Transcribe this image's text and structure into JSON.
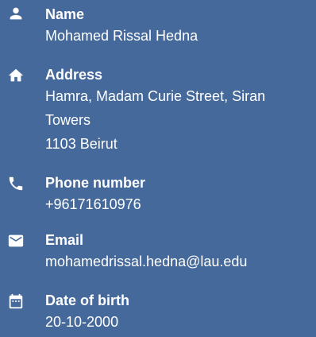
{
  "profile": {
    "name": {
      "label": "Name",
      "value": "Mohamed Rissal Hedna",
      "icon": "person-icon"
    },
    "address": {
      "label": "Address",
      "lines": [
        "Hamra, Madam Curie Street, Siran",
        "Towers",
        "1103 Beirut"
      ],
      "icon": "home-icon"
    },
    "phone": {
      "label": "Phone number",
      "value": "+96171610976",
      "icon": "phone-icon"
    },
    "email": {
      "label": "Email",
      "value": "mohamedrissal.hedna@lau.edu",
      "icon": "mail-icon"
    },
    "dob": {
      "label": "Date of birth",
      "value": "20-10-2000",
      "icon": "calendar-icon"
    }
  },
  "colors": {
    "background": "#45699a",
    "text": "#ffffff"
  }
}
